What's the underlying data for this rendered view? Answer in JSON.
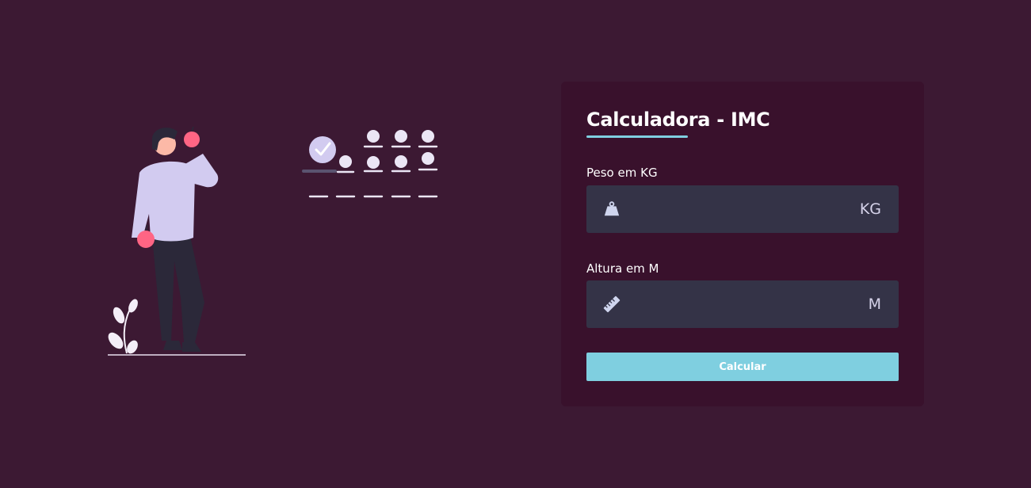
{
  "form": {
    "title": "Calculadora - IMC",
    "weight": {
      "label": "Peso em KG",
      "value": "",
      "placeholder": "",
      "unit": "KG",
      "icon": "weight-icon"
    },
    "height": {
      "label": "Altura em M",
      "value": "",
      "placeholder": "",
      "unit": "M",
      "icon": "ruler-icon"
    },
    "submit_label": "Calcular"
  },
  "colors": {
    "page_background": "#3c1933",
    "card_background": "#39112c",
    "input_background": "#343347",
    "accent": "#7fcfe0",
    "illustration_light": "#d2cbf0",
    "illustration_accent": "#ff6584"
  }
}
